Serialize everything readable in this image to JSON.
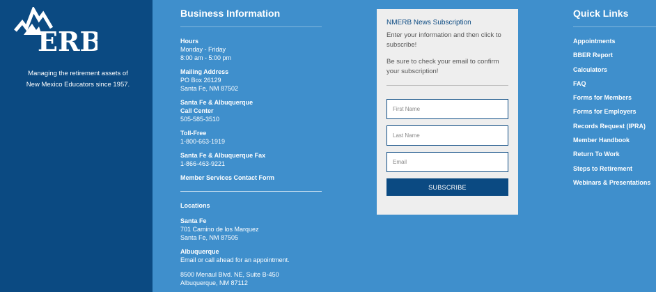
{
  "brand": {
    "logo_text": "ERB",
    "tagline_line1": "Managing the retirement assets of",
    "tagline_line2": "New Mexico Educators since 1957."
  },
  "business": {
    "title": "Business Information",
    "hours": {
      "label": "Hours",
      "line1": "Monday - Friday",
      "line2": "8:00 am - 5:00 pm"
    },
    "mailing": {
      "label": "Mailing Address",
      "line1": "PO Box 26129",
      "line2": "Santa Fe, NM 87502"
    },
    "callcenter": {
      "label1": "Santa Fe & Albuquerque",
      "label2": "Call Center",
      "line1": "505-585-3510"
    },
    "tollfree": {
      "label": "Toll-Free",
      "line1": "1-800-663-1919"
    },
    "fax": {
      "label": "Santa Fe & Albuquerque Fax",
      "line1": "1-866-463-9221"
    },
    "contact_link": "Member Services Contact Form",
    "locations_label": "Locations",
    "santafe": {
      "label": "Santa Fe",
      "line1": "701 Camino de los Marquez",
      "line2": "Santa Fe, NM 87505"
    },
    "albuquerque": {
      "label": "Albuquerque",
      "line1": "Email or call ahead for an appointment.",
      "line2": "8500 Menaul Blvd. NE, Suite B-450",
      "line3": "Albuquerque, NM 87112"
    }
  },
  "subscription": {
    "title": "NMERB News Subscription",
    "para1": "Enter your information and then click to subscribe!",
    "para2": "Be sure to check your email to confirm your subscription!",
    "first_name_placeholder": "First Name",
    "last_name_placeholder": "Last Name",
    "email_placeholder": "Email",
    "button_label": "SUBSCRIBE"
  },
  "quick_links": {
    "title": "Quick Links",
    "items": [
      "Appointments",
      "BBER Report",
      "Calculators",
      "FAQ",
      "Forms for Members",
      "Forms for Employers",
      "Records Request (IPRA)",
      "Member Handbook",
      "Return To Work",
      "Steps to Retirement",
      "Webinars & Presentations"
    ]
  },
  "colors": {
    "left_panel": "#0b4a82",
    "main_bg": "#3f8fcc",
    "card_bg": "#eeeeee",
    "button_bg": "#0b4a82"
  }
}
